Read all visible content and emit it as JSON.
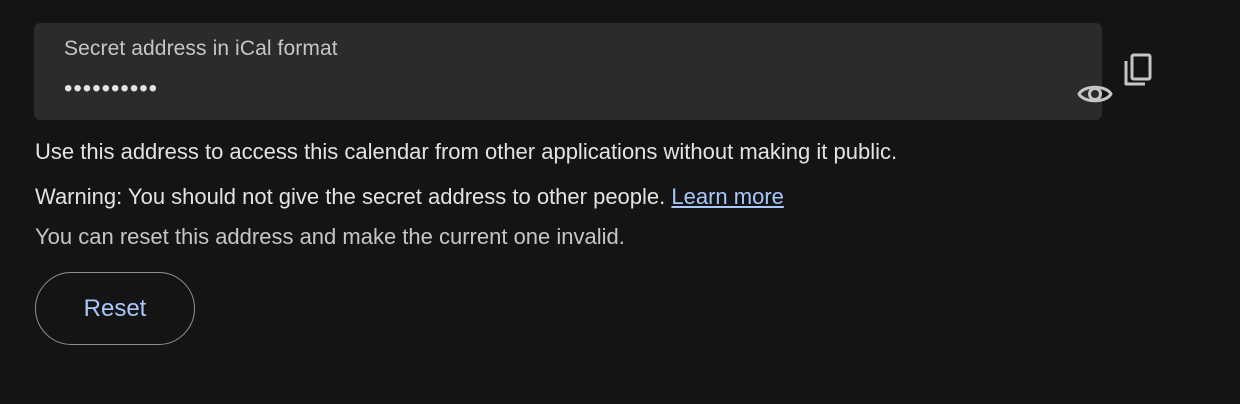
{
  "secret_field": {
    "label": "Secret address in iCal format",
    "masked_value": "••••••••••",
    "show_icon": "eye-icon",
    "copy_icon": "copy-icon"
  },
  "info": {
    "description": "Use this address to access this calendar from other applications without making it public.",
    "warning": "Warning: You should not give the secret address to other people.",
    "learn_more": "Learn more",
    "reset_note": "You can reset this address and make the current one invalid."
  },
  "reset_button": {
    "label": "Reset"
  },
  "colors": {
    "background": "#141414",
    "field_background": "#2a2b2d",
    "link": "#a8c7fa",
    "text": "#e3e3e3"
  }
}
